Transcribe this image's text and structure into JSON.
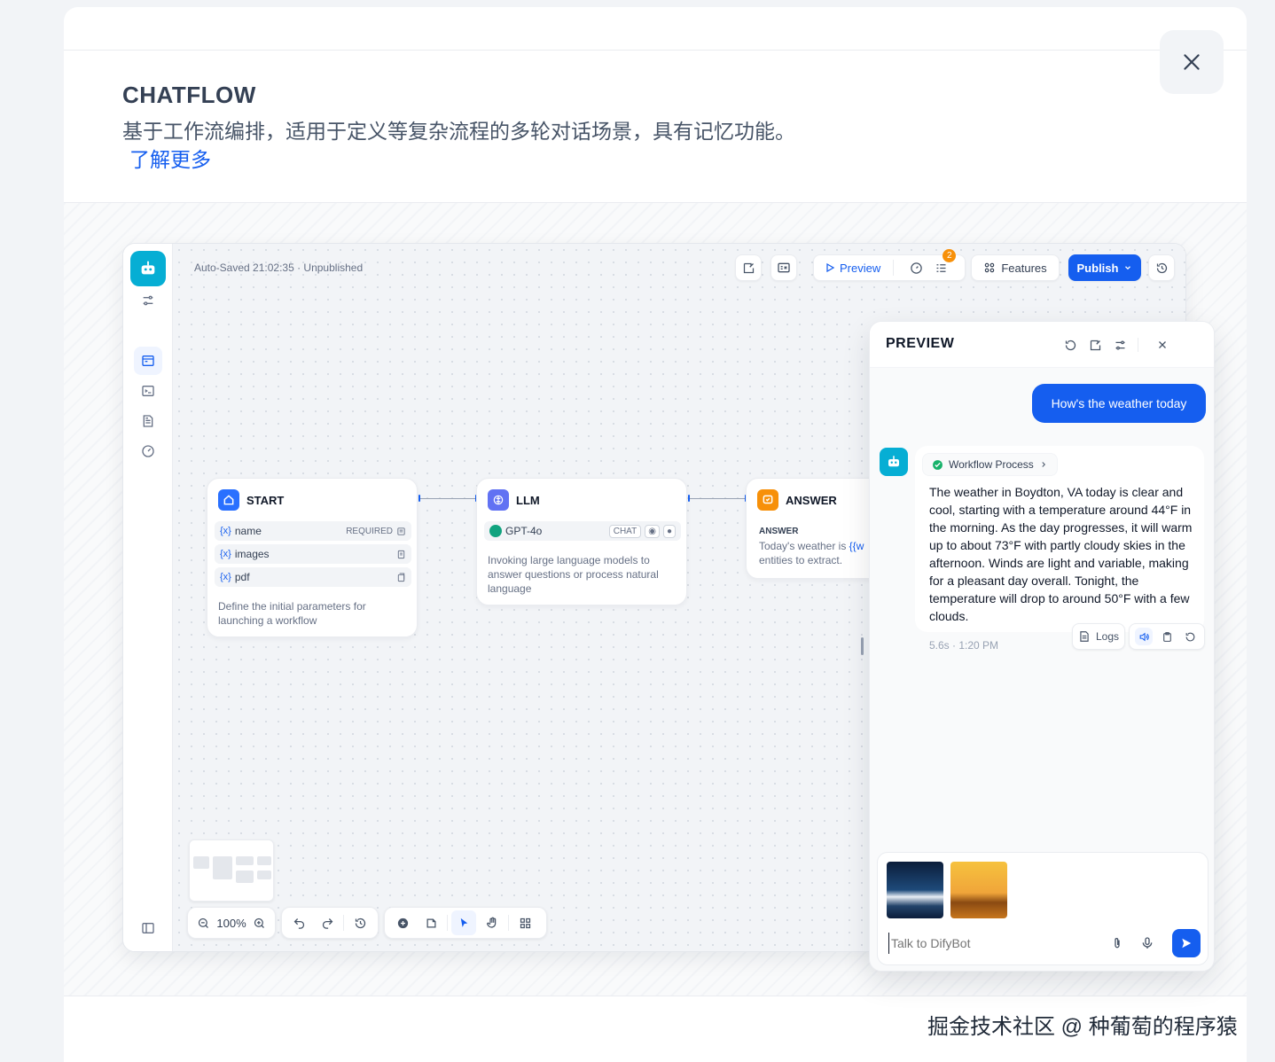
{
  "header": {
    "title": "CHATFLOW",
    "description": "基于工作流编排，适用于定义等复杂流程的多轮对话场景，具有记忆功能。",
    "learn_more": "了解更多"
  },
  "watermark": "掘金技术社区 @ 种葡萄的程序猿",
  "toolbar": {
    "autosave": "Auto-Saved 21:02:35 · Unpublished",
    "preview_label": "Preview",
    "checklist_badge": "2",
    "features_label": "Features",
    "publish_label": "Publish"
  },
  "nodes": {
    "start": {
      "title": "START",
      "variables": [
        {
          "name": "name",
          "tag": "REQUIRED"
        },
        {
          "name": "images",
          "tag": ""
        },
        {
          "name": "pdf",
          "tag": ""
        }
      ],
      "var_symbol": "{x}",
      "description": "Define the initial parameters for launching a workflow"
    },
    "llm": {
      "title": "LLM",
      "model": "GPT-4o",
      "mode_tag": "CHAT",
      "description": "Invoking large language models to answer questions or process natural language"
    },
    "answer": {
      "title": "ANSWER",
      "label": "ANSWER",
      "text_prefix": "Today's weather is ",
      "text_var": "{{w",
      "text_suffix": "entities to extract."
    }
  },
  "zoom": {
    "label": "100%"
  },
  "preview": {
    "title": "PREVIEW",
    "user_message": "How's the weather today",
    "workflow_process": "Workflow Process",
    "bot_message": "The weather in Boydton, VA today is clear and cool, starting with a temperature around 44°F in the morning. As the day progresses, it will warm up to about 73°F with partly cloudy skies in the afternoon. Winds are light and variable, making for a pleasant day overall. Tonight, the temperature will drop to around 50°F with a few clouds.",
    "meta": "5.6s · 1:20 PM",
    "logs_label": "Logs",
    "input_placeholder": "Talk to DifyBot"
  },
  "colors": {
    "primary": "#155eef",
    "bot_avatar": "#06aed4",
    "answer_node": "#f79009",
    "success": "#17b26a"
  }
}
